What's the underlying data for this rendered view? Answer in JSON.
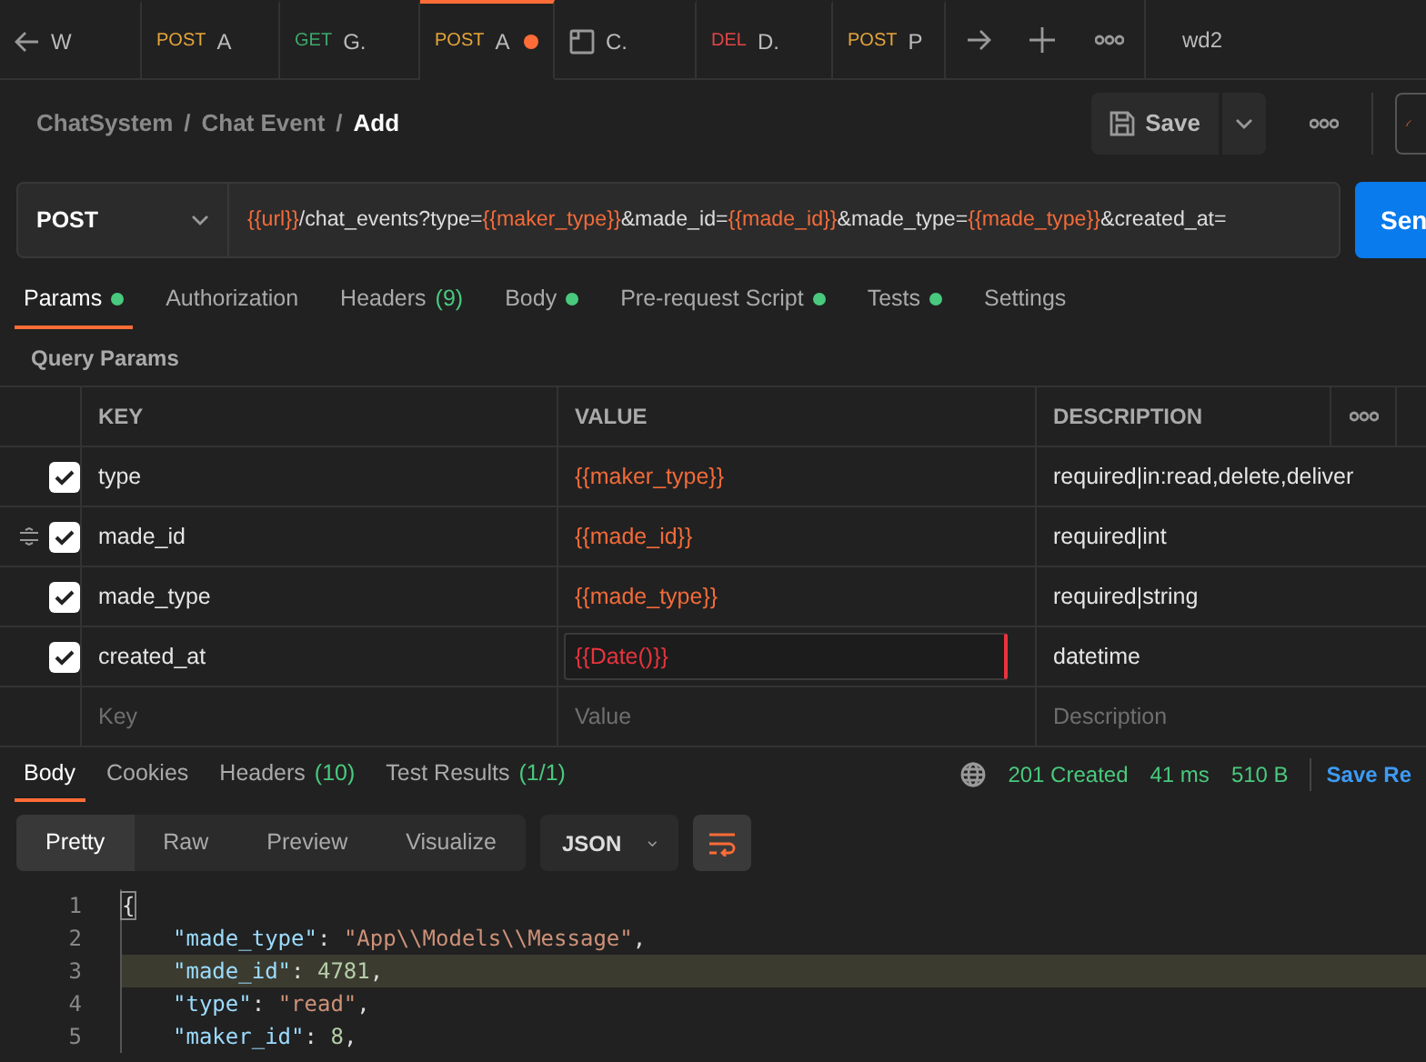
{
  "tabs": [
    {
      "kind": "back",
      "name": "W",
      "selected": false,
      "unsaved": false
    },
    {
      "kind": "request",
      "method": "POST",
      "name": "A",
      "selected": false,
      "unsaved": false
    },
    {
      "kind": "request",
      "method": "GET",
      "name": "G.",
      "selected": false,
      "unsaved": false
    },
    {
      "kind": "request",
      "method": "POST",
      "name": "A",
      "selected": true,
      "unsaved": true
    },
    {
      "kind": "doc",
      "name": "C.",
      "selected": false,
      "unsaved": false
    },
    {
      "kind": "request",
      "method": "DEL",
      "name": "D.",
      "selected": false,
      "unsaved": false
    },
    {
      "kind": "request",
      "method": "POST",
      "name": "P",
      "selected": false,
      "unsaved": false
    }
  ],
  "workspace": "wd2",
  "breadcrumb": [
    {
      "kind": "item",
      "text": "ChatSystem"
    },
    {
      "kind": "separator",
      "text": "/"
    },
    {
      "kind": "item",
      "text": "Chat Event"
    },
    {
      "kind": "separator",
      "text": "/"
    },
    {
      "kind": "current",
      "text": "Add"
    }
  ],
  "save_button": "Save",
  "request": {
    "method": "POST",
    "url": [
      {
        "text": "{{url}}",
        "variable": true
      },
      {
        "text": "/chat_events?type=",
        "variable": false
      },
      {
        "text": "{{maker_type}}",
        "variable": true
      },
      {
        "text": "&made_id=",
        "variable": false
      },
      {
        "text": "{{made_id}}",
        "variable": true
      },
      {
        "text": "&made_type=",
        "variable": false
      },
      {
        "text": "{{made_type}}",
        "variable": true
      },
      {
        "text": "&created_at=",
        "variable": false
      }
    ],
    "send_button": "Sen"
  },
  "request_tabs": [
    {
      "label": "Params",
      "has_data": true,
      "selected": true
    },
    {
      "label": "Authorization",
      "has_data": false,
      "selected": false
    },
    {
      "label": "Headers",
      "count": "(9)",
      "has_data": false,
      "selected": false
    },
    {
      "label": "Body",
      "has_data": true,
      "selected": false
    },
    {
      "label": "Pre-request Script",
      "has_data": true,
      "selected": false
    },
    {
      "label": "Tests",
      "has_data": true,
      "selected": false
    },
    {
      "label": "Settings",
      "has_data": false,
      "selected": false
    }
  ],
  "section_title": "Query Params",
  "params_table": {
    "columns": [
      "KEY",
      "VALUE",
      "DESCRIPTION"
    ],
    "rows": [
      {
        "checked": true,
        "hovered": false,
        "key": "type",
        "value": "{{maker_type}}",
        "resolved": true,
        "editing": false,
        "description": "required|in:read,delete,deliver"
      },
      {
        "checked": true,
        "hovered": true,
        "key": "made_id",
        "value": "{{made_id}}",
        "resolved": true,
        "editing": false,
        "description": "required|int"
      },
      {
        "checked": true,
        "hovered": false,
        "key": "made_type",
        "value": "{{made_type}}",
        "resolved": true,
        "editing": false,
        "description": "required|string"
      },
      {
        "checked": true,
        "hovered": false,
        "key": "created_at",
        "value": "{{Date()}}",
        "resolved": false,
        "editing": true,
        "description": "datetime"
      }
    ],
    "new_row": {
      "key": "Key",
      "value": "Value",
      "description": "Description"
    }
  },
  "response": {
    "tabs": [
      {
        "label": "Body",
        "selected": true
      },
      {
        "label": "Cookies",
        "selected": false
      },
      {
        "label": "Headers",
        "count": "(10)",
        "selected": false
      },
      {
        "label": "Test Results",
        "count": "(1/1)",
        "selected": false
      }
    ],
    "status": "201 Created",
    "time": "41 ms",
    "size": "510 B",
    "save_link": "Save Re",
    "views": [
      {
        "label": "Pretty",
        "selected": true
      },
      {
        "label": "Raw",
        "selected": false
      },
      {
        "label": "Preview",
        "selected": false
      },
      {
        "label": "Visualize",
        "selected": false
      }
    ],
    "format": "JSON",
    "wrap_lines": true,
    "code_lines": [
      {
        "number": "1",
        "highlighted": false,
        "tokens": [
          {
            "kind": "brace",
            "text": "{"
          }
        ]
      },
      {
        "number": "2",
        "highlighted": false,
        "tokens": [
          {
            "kind": "key",
            "text": "\"made_type\""
          },
          {
            "kind": "punct",
            "text": ": "
          },
          {
            "kind": "string",
            "text": "\"App\\\\Models\\\\Message\""
          },
          {
            "kind": "punct",
            "text": ","
          }
        ]
      },
      {
        "number": "3",
        "highlighted": true,
        "tokens": [
          {
            "kind": "key",
            "text": "\"made_id\""
          },
          {
            "kind": "punct",
            "text": ": "
          },
          {
            "kind": "number",
            "text": "4781"
          },
          {
            "kind": "punct",
            "text": ","
          }
        ]
      },
      {
        "number": "4",
        "highlighted": false,
        "tokens": [
          {
            "kind": "key",
            "text": "\"type\""
          },
          {
            "kind": "punct",
            "text": ": "
          },
          {
            "kind": "string",
            "text": "\"read\""
          },
          {
            "kind": "punct",
            "text": ","
          }
        ]
      },
      {
        "number": "5",
        "highlighted": false,
        "tokens": [
          {
            "kind": "key",
            "text": "\"maker_id\""
          },
          {
            "kind": "punct",
            "text": ": "
          },
          {
            "kind": "number",
            "text": "8"
          },
          {
            "kind": "punct",
            "text": ","
          }
        ]
      }
    ]
  }
}
